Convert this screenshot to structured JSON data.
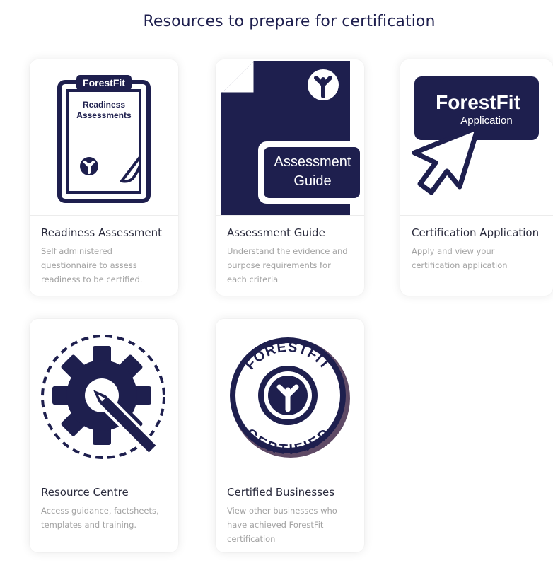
{
  "page": {
    "heading": "Resources to prepare for certification"
  },
  "colors": {
    "navy": "#1e1f4e",
    "title_text": "#2a2b3d",
    "muted_text": "#a2a2a2"
  },
  "cards": [
    {
      "title": "Readiness Assessment",
      "description": "Self administered questionnaire to assess readiness to be certified.",
      "icon": "clipboard-icon",
      "image_text": [
        "ForestFit",
        "Readiness",
        "Assessments"
      ]
    },
    {
      "title": "Assessment Guide",
      "description": "Understand the evidence and purpose requirements for each criteria",
      "icon": "document-icon",
      "image_text": [
        "Assessment",
        "Guide"
      ]
    },
    {
      "title": "Certification Application",
      "description": "Apply and view your certification application",
      "icon": "cursor-icon",
      "image_text": [
        "ForestFit",
        "Application"
      ]
    },
    {
      "title": "Resource Centre",
      "description": "Access guidance, factsheets, templates and training.",
      "icon": "gear-pencil-icon",
      "image_text": []
    },
    {
      "title": "Certified Businesses",
      "description": "View other businesses who have achieved ForestFit certification",
      "icon": "certified-badge-icon",
      "image_text": [
        "FORESTFIT",
        "CERTIFIED"
      ]
    }
  ]
}
